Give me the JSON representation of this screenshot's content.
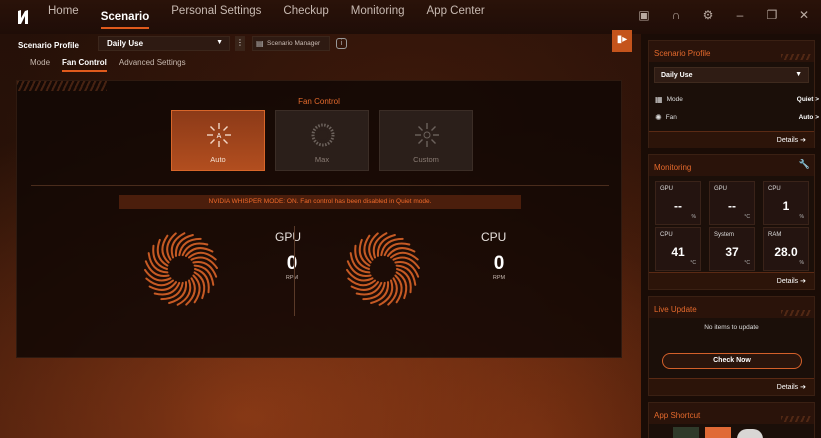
{
  "nav": {
    "tabs": [
      "Home",
      "Scenario",
      "Personal Settings",
      "Checkup",
      "Monitoring",
      "App Center"
    ],
    "active": "Scenario"
  },
  "subheader": {
    "profile_label": "Scenario Profile",
    "profile_value": "Daily Use",
    "manager_label": "Scenario Manager"
  },
  "tabs": [
    "Mode",
    "Fan Control",
    "Advanced Settings"
  ],
  "fan_control": {
    "title": "Fan Control",
    "modes": [
      {
        "label": "Auto",
        "active": true
      },
      {
        "label": "Max",
        "active": false
      },
      {
        "label": "Custom",
        "active": false
      }
    ],
    "warning": "NVIDIA WHISPER MODE: ON. Fan control has been disabled in Quiet mode.",
    "gpu": {
      "label": "GPU",
      "value": "0",
      "unit": "RPM"
    },
    "cpu": {
      "label": "CPU",
      "value": "0",
      "unit": "RPM"
    }
  },
  "sidebar": {
    "scenario_profile": {
      "title": "Scenario Profile",
      "selected": "Daily Use",
      "rows": [
        {
          "label": "Mode",
          "value": "Quiet >"
        },
        {
          "label": "Fan",
          "value": "Auto >"
        }
      ],
      "details": "Details"
    },
    "monitoring": {
      "title": "Monitoring",
      "cells": [
        {
          "title": "GPU",
          "value": "--",
          "unit": "%"
        },
        {
          "title": "GPU",
          "value": "--",
          "unit": "°C"
        },
        {
          "title": "CPU",
          "value": "1",
          "unit": "%"
        },
        {
          "title": "CPU",
          "value": "41",
          "unit": "°C"
        },
        {
          "title": "System",
          "value": "37",
          "unit": "°C"
        },
        {
          "title": "RAM",
          "value": "28.0",
          "unit": "%"
        }
      ],
      "details": "Details"
    },
    "live_update": {
      "title": "Live Update",
      "message": "No items to update",
      "button": "Check Now",
      "details": "Details"
    },
    "app_shortcut": {
      "title": "App Shortcut"
    }
  },
  "colors": {
    "accent": "#e05a1c",
    "accent_text": "#e4692c"
  }
}
